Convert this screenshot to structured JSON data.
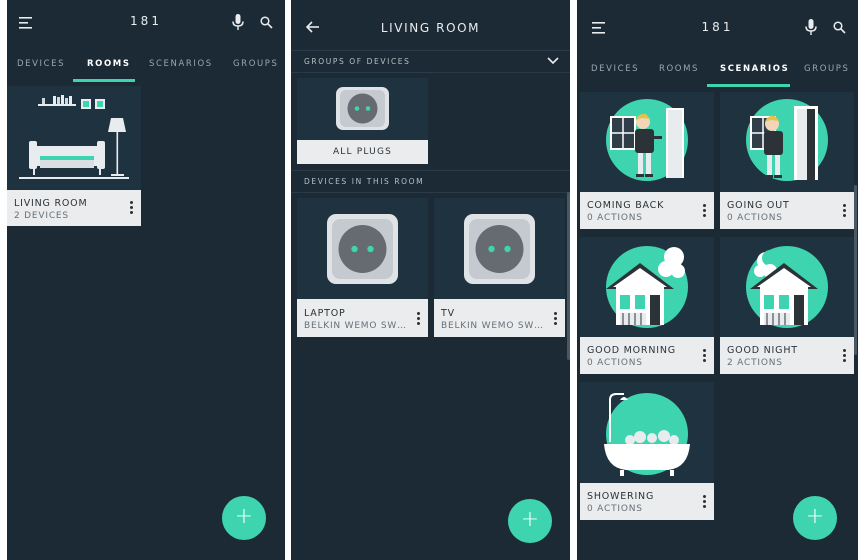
{
  "screens": {
    "rooms": {
      "title": "181",
      "tabs": [
        "DEVICES",
        "ROOMS",
        "SCENARIOS",
        "GROUPS"
      ],
      "active_tab": "ROOMS",
      "cards": [
        {
          "name": "LIVING ROOM",
          "sub": "2 DEVICES",
          "art": "living-room-illustration"
        }
      ]
    },
    "living_room": {
      "title": "LIVING ROOM",
      "groups_heading": "GROUPS OF DEVICES",
      "group_card": {
        "label": "ALL PLUGS",
        "art": "plug-icon"
      },
      "devices_heading": "DEVICES IN THIS ROOM",
      "devices": [
        {
          "name": "LAPTOP",
          "sub": "BELKIN WEMO SW…",
          "art": "plug-icon"
        },
        {
          "name": "TV",
          "sub": "BELKIN WEMO SW…",
          "art": "plug-icon"
        }
      ]
    },
    "scenarios": {
      "title": "181",
      "tabs": [
        "DEVICES",
        "ROOMS",
        "SCENARIOS",
        "GROUPS"
      ],
      "active_tab": "SCENARIOS",
      "cards": [
        {
          "name": "COMING BACK",
          "sub": "0 ACTIONS",
          "art": "person-coming-back-illustration"
        },
        {
          "name": "GOING OUT",
          "sub": "0 ACTIONS",
          "art": "person-going-out-illustration"
        },
        {
          "name": "GOOD MORNING",
          "sub": "0 ACTIONS",
          "art": "house-sun-illustration"
        },
        {
          "name": "GOOD NIGHT",
          "sub": "2 ACTIONS",
          "art": "house-moon-illustration"
        },
        {
          "name": "SHOWERING",
          "sub": "0 ACTIONS",
          "art": "bathtub-illustration"
        }
      ]
    }
  },
  "icons": {
    "menu": "hamburger-menu-icon",
    "mic": "microphone-icon",
    "search": "search-icon",
    "back": "back-arrow-icon",
    "chevron": "chevron-down-icon",
    "more": "more-vertical-icon",
    "add": "add-icon"
  },
  "fab_label": "+",
  "colors": {
    "background": "#1c2a35",
    "card": "#1f3240",
    "accent": "#3fd4b0",
    "card_footer": "#eaeced",
    "text_light": "#e8ecef"
  }
}
